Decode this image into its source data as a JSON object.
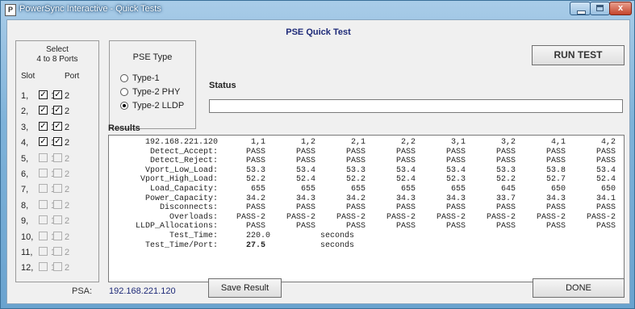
{
  "window": {
    "title": "PowerSync Interactive - Quick Tests",
    "icon": "app-icon",
    "close_glyph": "x"
  },
  "heading": "PSE Quick Test",
  "port_select": {
    "title_line1": "Select",
    "title_line2": "4 to 8 Ports",
    "slot_header": "Slot",
    "port_header": "Port",
    "rows": [
      {
        "slot": "1,",
        "p1_checked": true,
        "p2_checked": true,
        "enabled": true
      },
      {
        "slot": "2,",
        "p1_checked": true,
        "p2_checked": true,
        "enabled": true
      },
      {
        "slot": "3,",
        "p1_checked": true,
        "p2_checked": true,
        "enabled": true
      },
      {
        "slot": "4,",
        "p1_checked": true,
        "p2_checked": true,
        "enabled": true
      },
      {
        "slot": "5,",
        "p1_checked": false,
        "p2_checked": false,
        "enabled": false
      },
      {
        "slot": "6,",
        "p1_checked": false,
        "p2_checked": false,
        "enabled": false
      },
      {
        "slot": "7,",
        "p1_checked": false,
        "p2_checked": false,
        "enabled": false
      },
      {
        "slot": "8,",
        "p1_checked": false,
        "p2_checked": false,
        "enabled": false
      },
      {
        "slot": "9,",
        "p1_checked": false,
        "p2_checked": false,
        "enabled": false
      },
      {
        "slot": "10,",
        "p1_checked": false,
        "p2_checked": false,
        "enabled": false
      },
      {
        "slot": "11,",
        "p1_checked": false,
        "p2_checked": false,
        "enabled": false
      },
      {
        "slot": "12,",
        "p1_checked": false,
        "p2_checked": false,
        "enabled": false
      }
    ],
    "port1_label": "1",
    "port2_label": "2",
    "check_glyph": "✓"
  },
  "pse_type": {
    "title": "PSE Type",
    "options": [
      "Type-1",
      "Type-2 PHY",
      "Type-2 LLDP"
    ],
    "selected": "Type-2 LLDP"
  },
  "status": {
    "label": "Status",
    "value": ""
  },
  "run_button": "RUN TEST",
  "results": {
    "label": "Results",
    "rows": [
      [
        "192.168.221.120",
        "1,1",
        "1,2",
        "2,1",
        "2,2",
        "3,1",
        "3,2",
        "4,1",
        "4,2"
      ],
      [
        "Detect_Accept:",
        "PASS",
        "PASS",
        "PASS",
        "PASS",
        "PASS",
        "PASS",
        "PASS",
        "PASS"
      ],
      [
        "Detect_Reject:",
        "PASS",
        "PASS",
        "PASS",
        "PASS",
        "PASS",
        "PASS",
        "PASS",
        "PASS"
      ],
      [
        "Vport_Low_Load:",
        "53.3",
        "53.4",
        "53.3",
        "53.4",
        "53.4",
        "53.3",
        "53.8",
        "53.4"
      ],
      [
        "Vport_High_Load:",
        "52.2",
        "52.4",
        "52.2",
        "52.4",
        "52.3",
        "52.2",
        "52.7",
        "52.4"
      ],
      [
        "Load_Capacity:",
        "655",
        "655",
        "655",
        "655",
        "655",
        "645",
        "650",
        "650"
      ],
      [
        "Power_Capacity:",
        "34.2",
        "34.3",
        "34.2",
        "34.3",
        "34.3",
        "33.7",
        "34.3",
        "34.1"
      ],
      [
        "Disconnects:",
        "PASS",
        "PASS",
        "PASS",
        "PASS",
        "PASS",
        "PASS",
        "PASS",
        "PASS"
      ],
      [
        "Overloads:",
        "PASS-2",
        "PASS-2",
        "PASS-2",
        "PASS-2",
        "PASS-2",
        "PASS-2",
        "PASS-2",
        "PASS-2"
      ],
      [
        "LLDP_Allocations:",
        "PASS",
        "PASS",
        "PASS",
        "PASS",
        "PASS",
        "PASS",
        "PASS",
        "PASS"
      ]
    ],
    "test_time_label": "Test_Time:",
    "test_time_value": "220.0",
    "test_time_units": "seconds",
    "time_per_port_label": "Test_Time/Port:",
    "time_per_port_value": "27.5",
    "time_per_port_units": "seconds"
  },
  "psa_label": "PSA:",
  "psa_ip": "192.168.221.120",
  "save_button": "Save Result",
  "done_button": "DONE"
}
